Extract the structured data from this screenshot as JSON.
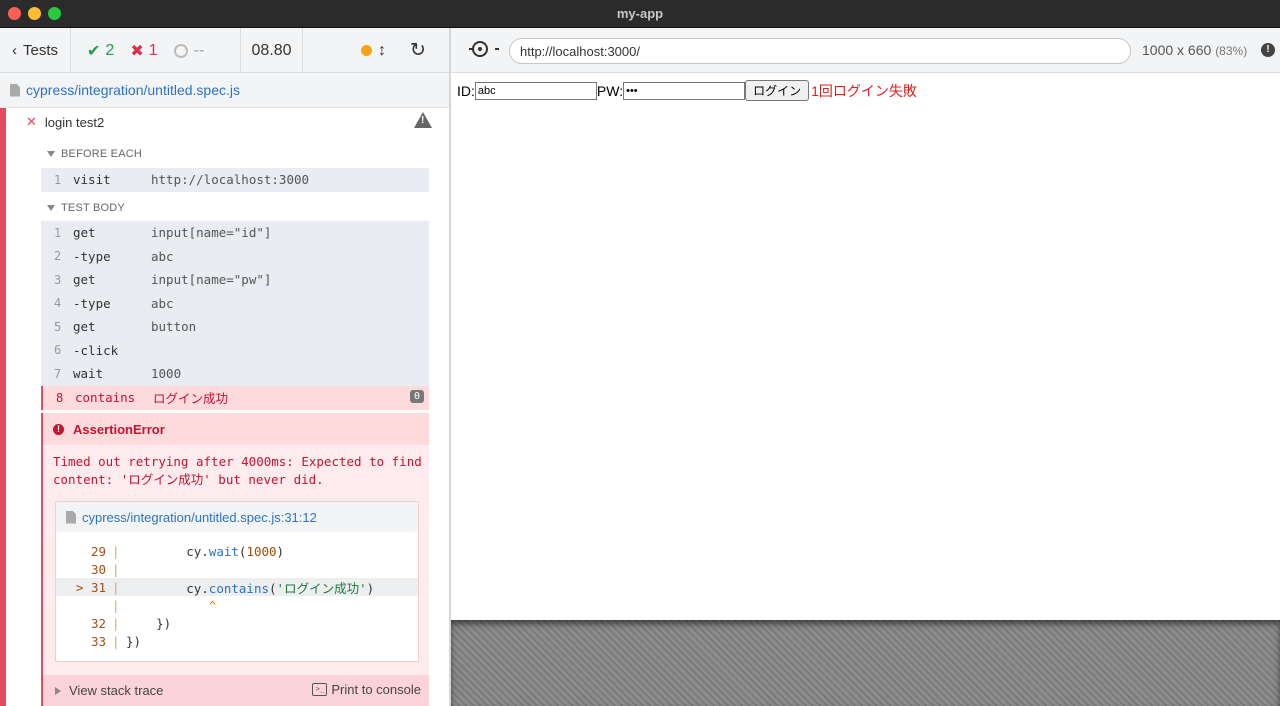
{
  "window": {
    "title": "my-app"
  },
  "reporter": {
    "tests_label": "Tests",
    "passed": "2",
    "failed": "1",
    "pending": "--",
    "duration": "08.80",
    "spec_path": "cypress/integration/untitled.spec.js",
    "test": {
      "title": "login test2",
      "before_each_label": "BEFORE EACH",
      "before_each": [
        {
          "num": "1",
          "name": "visit",
          "msg": "http://localhost:3000"
        }
      ],
      "test_body_label": "TEST BODY",
      "groups": [
        [
          {
            "num": "1",
            "name": "get",
            "msg": "input[name=\"id\"]"
          },
          {
            "num": "2",
            "name": "-type",
            "msg": "abc"
          }
        ],
        [
          {
            "num": "3",
            "name": "get",
            "msg": "input[name=\"pw\"]"
          },
          {
            "num": "4",
            "name": "-type",
            "msg": "abc"
          }
        ],
        [
          {
            "num": "5",
            "name": "get",
            "msg": "button"
          },
          {
            "num": "6",
            "name": "-click",
            "msg": ""
          }
        ],
        [
          {
            "num": "7",
            "name": "wait",
            "msg": "1000"
          }
        ]
      ],
      "failed_command": {
        "num": "8",
        "name": "contains",
        "msg": "ログイン成功",
        "badge": "0"
      }
    },
    "error": {
      "name": "AssertionError",
      "message": "Timed out retrying after 4000ms: Expected to find content: 'ログイン成功' but never did.",
      "code_frame_path": "cypress/integration/untitled.spec.js:31:12",
      "code_lines": [
        {
          "gutter": "  29",
          "pipe": "|",
          "pre": "        cy.",
          "fn": "wait",
          "open": "(",
          "arg": "1000",
          "close": ")",
          "arg_type": "num"
        },
        {
          "gutter": "  30",
          "pipe": "|",
          "pre": "",
          "fn": "",
          "open": "",
          "arg": "",
          "close": "",
          "arg_type": ""
        },
        {
          "gutter": "> 31",
          "pipe": "|",
          "pre": "        cy.",
          "fn": "contains",
          "open": "(",
          "arg": "'ログイン成功'",
          "close": ")",
          "arg_type": "str",
          "highlight": true
        },
        {
          "gutter": "    ",
          "pipe": "|",
          "pre": "           ",
          "fn": "",
          "open": "",
          "arg": "^",
          "close": "",
          "arg_type": "caret"
        },
        {
          "gutter": "  32",
          "pipe": "|",
          "pre": "    })",
          "fn": "",
          "open": "",
          "arg": "",
          "close": "",
          "arg_type": ""
        },
        {
          "gutter": "  33",
          "pipe": "|",
          "pre": "})",
          "fn": "",
          "open": "",
          "arg": "",
          "close": "",
          "arg_type": ""
        }
      ],
      "view_stack_trace": "View stack trace",
      "print_to_console": "Print to console",
      "terminal_icon_text": ">_"
    }
  },
  "aut": {
    "url": "http://localhost:3000/",
    "viewport": "1000 x 660",
    "zoom": "(83%)",
    "form": {
      "id_label": "ID:",
      "id_value": "abc",
      "pw_label": "PW:",
      "pw_value": "abc",
      "login_button": "ログイン",
      "status_message": "1回ログイン失敗"
    }
  },
  "colors": {
    "pass": "#1c9f4f",
    "fail": "#e34a63",
    "link": "#2c72c8",
    "error_text": "#c41430",
    "running_dot": "#f4a31a"
  }
}
